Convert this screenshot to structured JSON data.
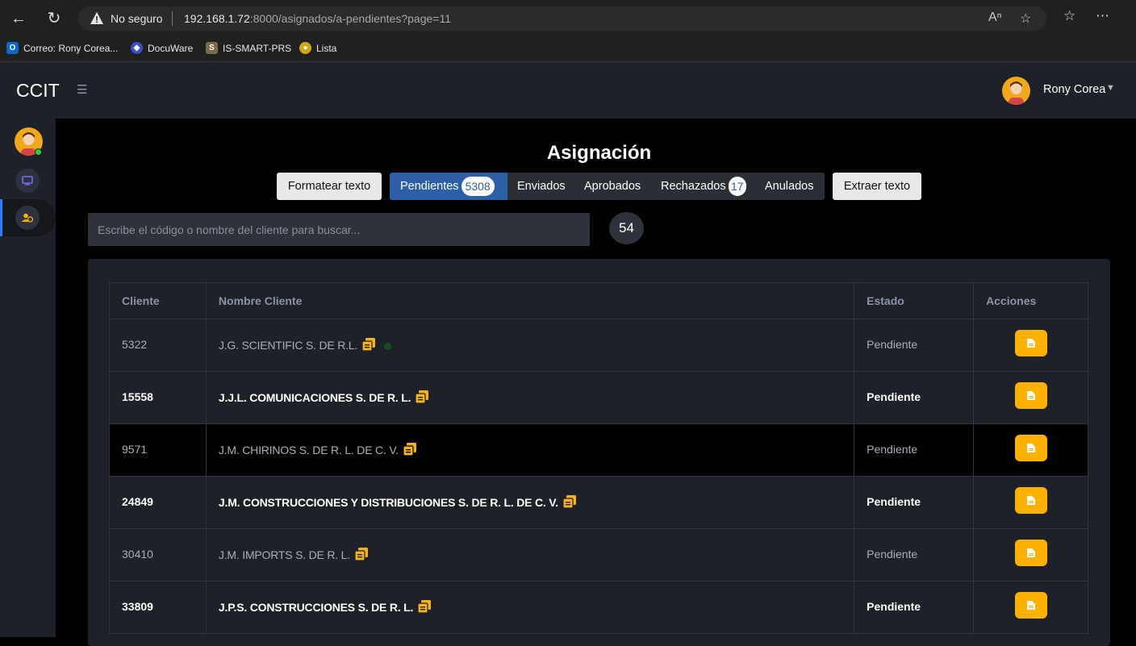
{
  "browser": {
    "security": "No seguro",
    "url_host": "192.168.1.72",
    "url_rest": ":8000/asignados/a-pendientes?page=11",
    "bookmarks": [
      {
        "label": "Correo: Rony Corea...",
        "icon": "outlook-icon",
        "color": "#0a66c8"
      },
      {
        "label": "DocuWare",
        "icon": "docuware-icon",
        "color": "#3d4cc8"
      },
      {
        "label": "IS-SMART-PRS",
        "icon": "is-smart-icon",
        "color": "#7a6a4a"
      },
      {
        "label": "Lista",
        "icon": "lista-icon",
        "color": "#d4a617"
      }
    ]
  },
  "header": {
    "brand": "CCIT",
    "user_name": "Rony Corea"
  },
  "page": {
    "title": "Asignación",
    "format_button": "Formatear texto",
    "extract_button": "Extraer texto",
    "tabs": [
      {
        "label": "Pendientes",
        "count": "5308"
      },
      {
        "label": "Enviados"
      },
      {
        "label": "Aprobados"
      },
      {
        "label": "Rechazados",
        "count": "17"
      },
      {
        "label": "Anulados"
      }
    ],
    "search_placeholder": "Escribe el código o nombre del cliente para buscar...",
    "result_count": "54"
  },
  "table": {
    "headers": [
      "Cliente",
      "Nombre Cliente",
      "Estado",
      "Acciones"
    ],
    "rows": [
      {
        "code": "5322",
        "name": "J.G. SCIENTIFIC S. DE R.L.",
        "status": "Pendiente"
      },
      {
        "code": "15558",
        "name": "J.J.L. COMUNICACIONES S. DE R. L.",
        "status": "Pendiente"
      },
      {
        "code": "9571",
        "name": "J.M. CHIRINOS S. DE R. L. DE C. V.",
        "status": "Pendiente"
      },
      {
        "code": "24849",
        "name": "J.M. CONSTRUCCIONES Y DISTRIBUCIONES S. DE R. L. DE C. V.",
        "status": "Pendiente"
      },
      {
        "code": "30410",
        "name": "J.M. IMPORTS S. DE R. L.",
        "status": "Pendiente"
      },
      {
        "code": "33809",
        "name": "J.P.S. CONSTRUCCIONES S. DE R. L.",
        "status": "Pendiente"
      }
    ]
  },
  "colors": {
    "accent": "#ffb100",
    "active_tab": "#2c5fa6",
    "online": "#2ecc40"
  }
}
